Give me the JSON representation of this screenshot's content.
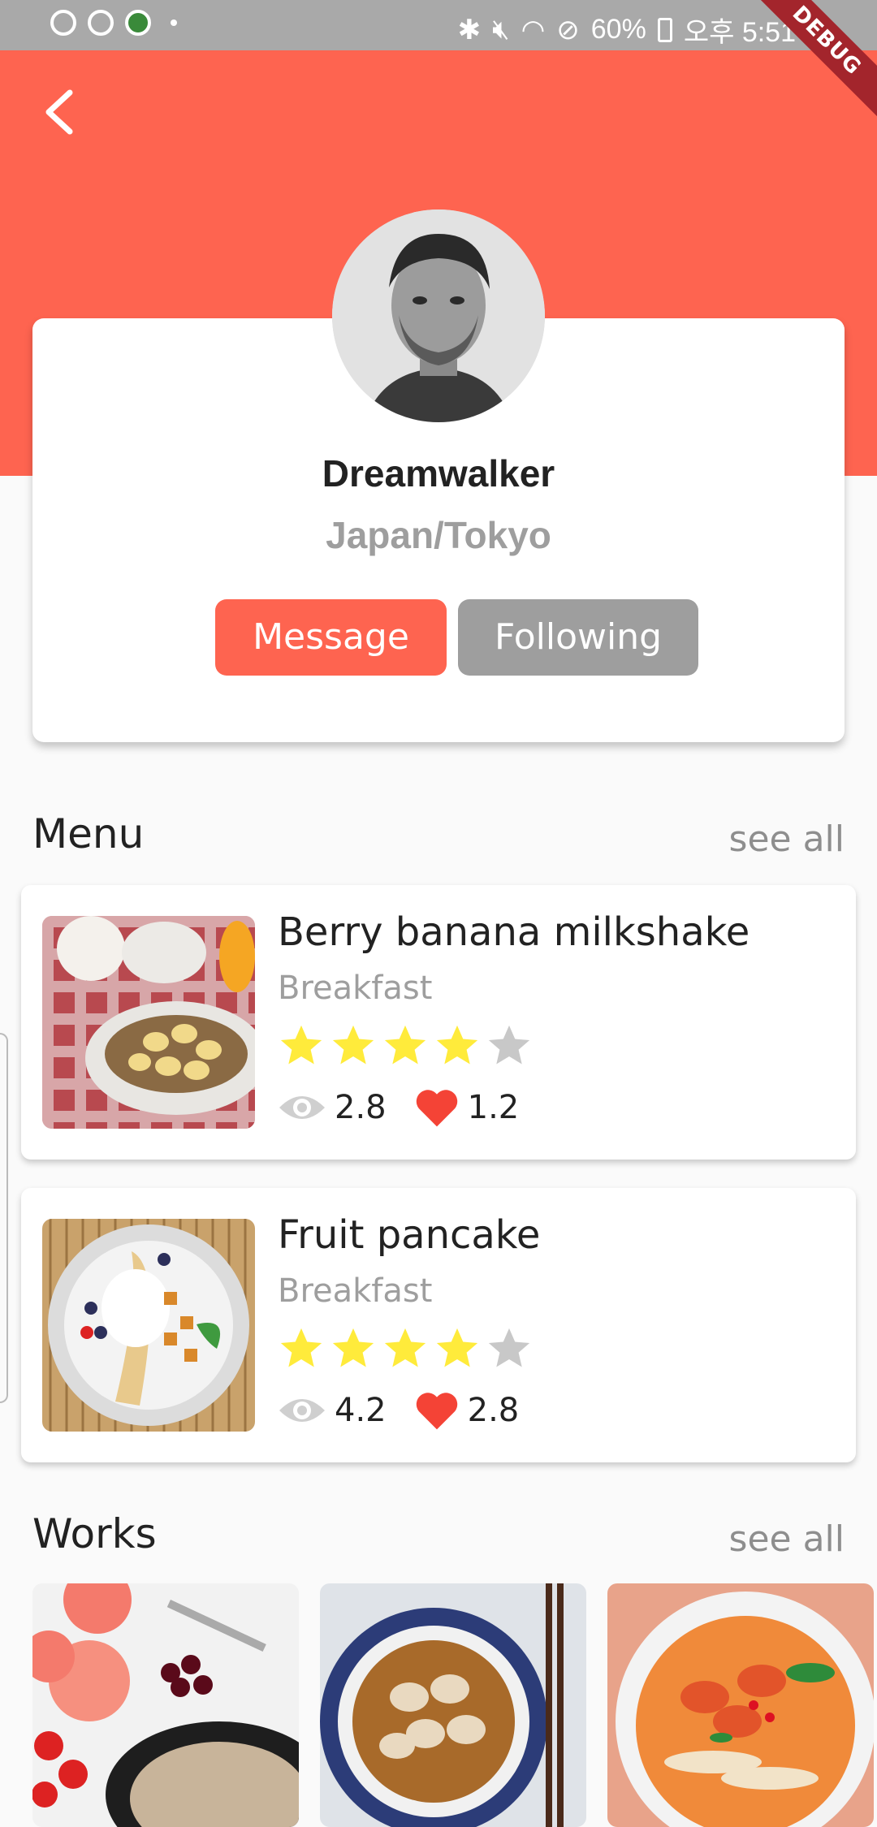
{
  "status_bar": {
    "battery": "60%",
    "time": "오후 5:51"
  },
  "debug_banner": "DEBUG",
  "profile": {
    "name": "Dreamwalker",
    "location": "Japan/Tokyo",
    "message_label": "Message",
    "following_label": "Following"
  },
  "menu": {
    "title": "Menu",
    "see_all": "see all",
    "items": [
      {
        "title": "Berry banana milkshake",
        "category": "Breakfast",
        "rating": 4,
        "views": "2.8",
        "likes": "1.2"
      },
      {
        "title": "Fruit pancake",
        "category": "Breakfast",
        "rating": 4,
        "views": "4.2",
        "likes": "2.8"
      }
    ]
  },
  "works": {
    "title": "Works",
    "see_all": "see all"
  },
  "colors": {
    "accent": "#fe6450",
    "star": "#ffeb3b",
    "star_empty": "#c8c8c8",
    "heart": "#f44336",
    "following": "#9e9e9e"
  }
}
